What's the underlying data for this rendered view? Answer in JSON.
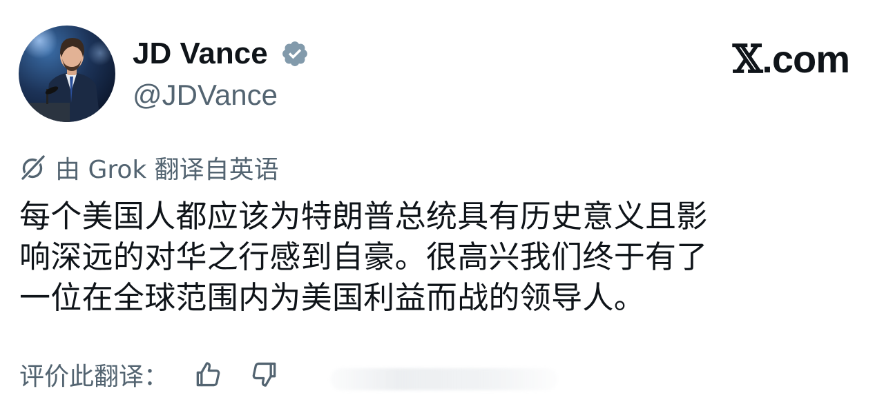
{
  "profile": {
    "display_name": "JD Vance",
    "handle": "@JDVance"
  },
  "site": {
    "brand_mark": "𝕏",
    "brand_text": ".com"
  },
  "translation": {
    "label": "由 Grok 翻译自英语"
  },
  "tweet": {
    "lines": [
      "每个美国人都应该为特朗普总统具有历史意义且影",
      "响深远的对华之行感到自豪。很高兴我们终于有了",
      "一位在全球范围内为美国利益而战的领导人。"
    ]
  },
  "rating": {
    "label": "评价此翻译："
  },
  "colors": {
    "text_primary": "#0f1419",
    "text_secondary": "#536471",
    "verified_badge": "#829aab",
    "background": "#ffffff"
  },
  "icons": {
    "verified": "verified-badge-icon",
    "grok": "grok-icon",
    "thumbs_up": "thumbs-up-icon",
    "thumbs_down": "thumbs-down-icon"
  }
}
